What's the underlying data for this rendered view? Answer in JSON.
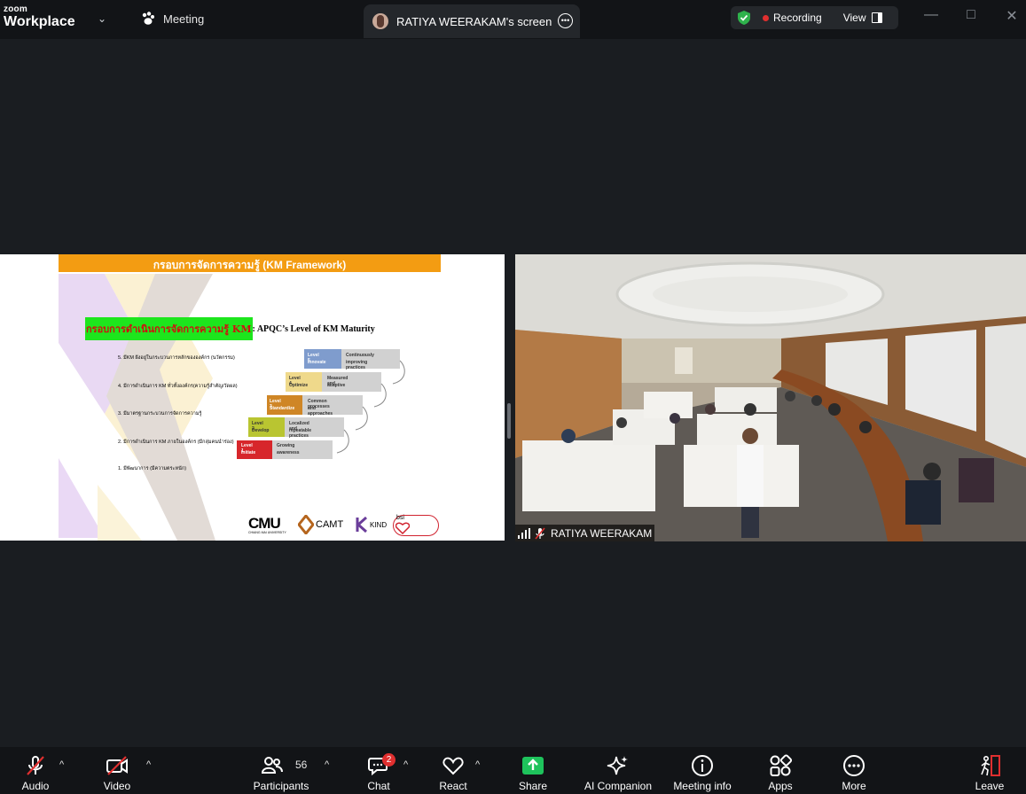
{
  "app": {
    "brand_top": "zoom",
    "brand_name": "Workplace"
  },
  "tabs": {
    "meeting": "Meeting",
    "screen": "RATIYA WEERAKAM's screen"
  },
  "status": {
    "recording": "Recording",
    "view": "View"
  },
  "colors": {
    "recording_dot": "#e02f2f",
    "shield": "#2fb24c",
    "share": "#1ec35c",
    "badge": "#e02f2f"
  },
  "slide": {
    "header": "กรอบการจัดการความรู้ (KM Framework)",
    "title_thai": "กรอบการดำเนินการจัดการความรู้ KM",
    "title_en": ": APQC’s Level of KM Maturity",
    "items": [
      "5. มีKM ฝังอยู่ในกระบวนการหลักขององค์กร (นวัตกรรม)",
      "4. มีการดำเนินการ KM ทั่วทั้งองค์กร(ความรู้สำคัญ/วัดผล)",
      "3. มีมาตรฐานกระบวนการจัดการความรู้",
      "2. มีการดำเนินการ KM ภายในองค์กร (มีกลุ่มคนนำร่อง)",
      "1. มีพัฒนาการ (มีความตระหนัก)"
    ],
    "levels": [
      {
        "level": "Level 1",
        "name": "Initiate",
        "desc1": "Growing",
        "desc2": "awareness",
        "color": "#d7262b"
      },
      {
        "level": "Level 2",
        "name": "Develop",
        "desc1": "Localized and",
        "desc2": "repeatable practices",
        "color": "#b9c531"
      },
      {
        "level": "Level 3",
        "name": "Standardize",
        "desc1": "Common processes",
        "desc2": "and approaches",
        "color": "#cf8626"
      },
      {
        "level": "Level 4",
        "name": "Optimize",
        "desc1": "Measured and",
        "desc2": "adaptive",
        "color": "#efd98b"
      },
      {
        "level": "Level 5",
        "name": "Innovate",
        "desc1": "Continuously",
        "desc2": "improving practices",
        "color": "#7f9ccd"
      }
    ],
    "logos": {
      "cmu": "CMU",
      "cmu_sub": "CHIANG MAI UNIVERSITY",
      "camt": "CAMT",
      "kind": "KIND",
      "bsi": "bsi"
    }
  },
  "video": {
    "name": "RATIYA WEERAKAM"
  },
  "toolbar": {
    "audio": "Audio",
    "video": "Video",
    "participants": "Participants",
    "participants_count": "56",
    "chat": "Chat",
    "chat_badge": "2",
    "react": "React",
    "share": "Share",
    "ai_companion": "AI Companion",
    "meeting_info": "Meeting info",
    "apps": "Apps",
    "more": "More",
    "leave": "Leave"
  }
}
